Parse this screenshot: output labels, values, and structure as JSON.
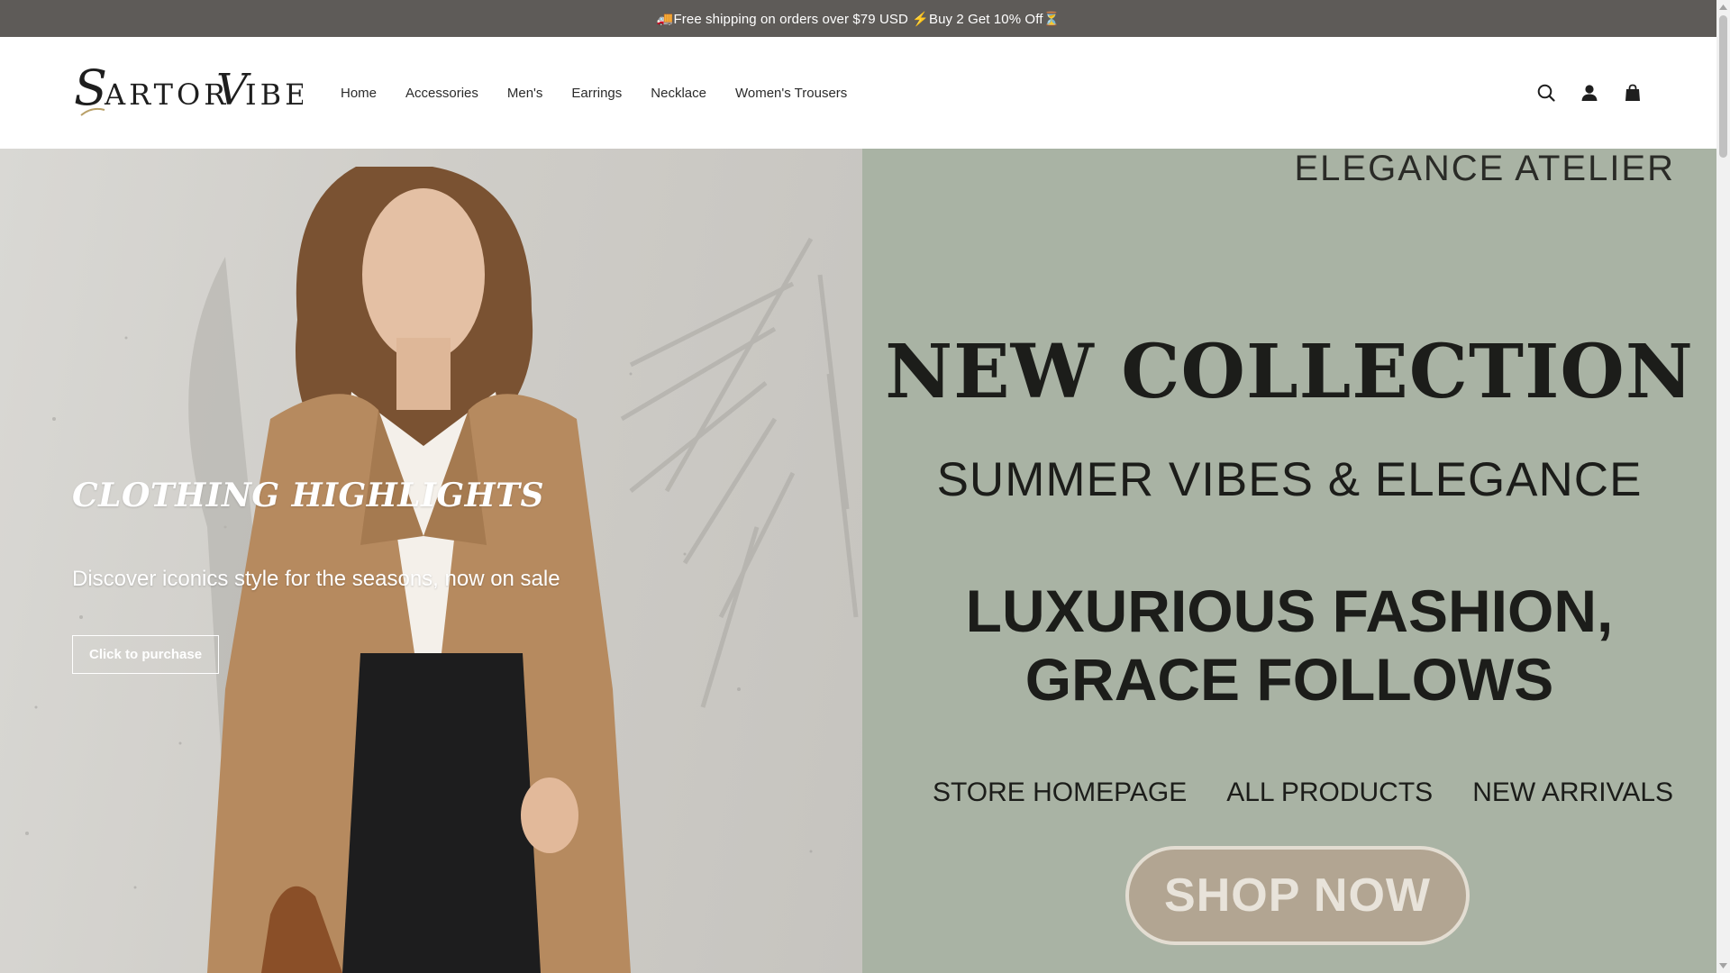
{
  "announcement": {
    "text": "🚚Free shipping on orders over $79 USD ⚡Buy 2 Get 10% Off⏳"
  },
  "brand": {
    "logo_text": "SartorVibe"
  },
  "nav": {
    "items": [
      {
        "label": "Home"
      },
      {
        "label": "Accessories"
      },
      {
        "label": "Men's"
      },
      {
        "label": "Earrings"
      },
      {
        "label": "Necklace"
      },
      {
        "label": "Women's Trousers"
      }
    ]
  },
  "header_icons": [
    "search-icon",
    "account-icon",
    "cart-icon"
  ],
  "hero": {
    "title": "CLOTHING HIGHLIGHTS",
    "subtitle": "Discover iconics style for the seasons, now on sale",
    "button_label": "Click to purchase"
  },
  "poster": {
    "atelier": "ELEGANCE ATELIER",
    "headline": "NEW COLLECTION",
    "subheadline": "SUMMER VIBES & ELEGANCE",
    "tagline_line1": "LUXURIOUS FASHION,",
    "tagline_line2": "GRACE FOLLOWS",
    "links": [
      "STORE HOMEPAGE",
      "ALL PRODUCTS",
      "NEW ARRIVALS"
    ],
    "cta": "SHOP NOW"
  },
  "colors": {
    "announcement_bg": "#5e5b58",
    "poster_bg": "#a9b3a4",
    "shop_now_bg": "#b2a592"
  }
}
